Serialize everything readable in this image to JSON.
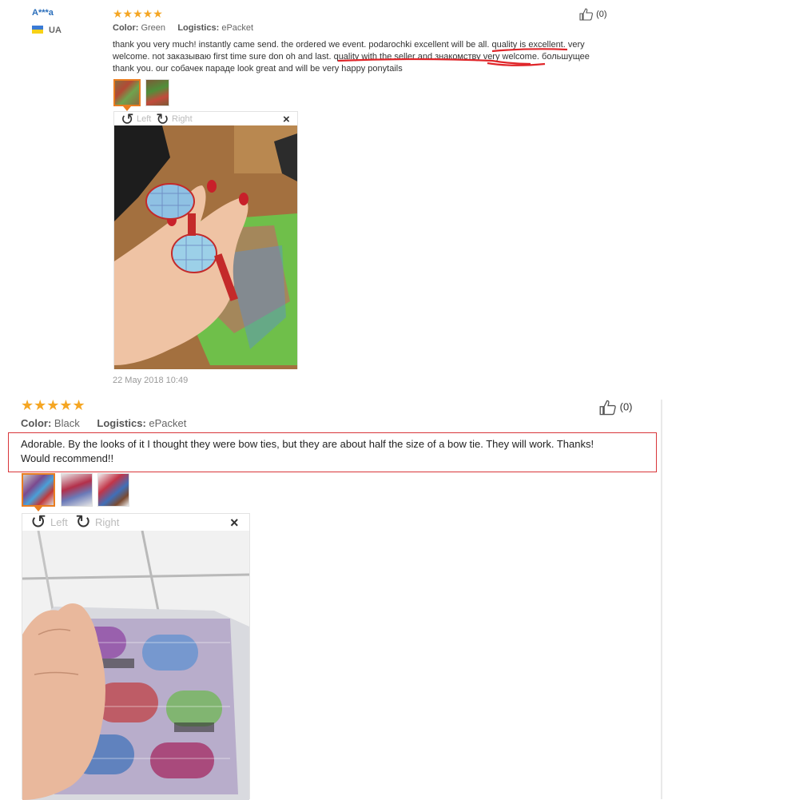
{
  "review1": {
    "user_name": "A***a",
    "country": "UA",
    "stars": "★★★★★",
    "color_label": "Color:",
    "color_value": "Green",
    "logistics_label": "Logistics:",
    "logistics_value": "ePacket",
    "like_count": "(0)",
    "text_line1": "thank you very much! instantly came send. the ordered we event. podarochki excellent will be all. quality is excellent. very",
    "text_line2": "welcome. not заказываю first time sure don oh and last. quality with the seller and знакомству very welcome. большущее",
    "text_line3": "thank you. our собачек параде look great and will be very happy ponytails",
    "rotate_left": "Left",
    "rotate_right": "Right",
    "close": "×",
    "date": "22 May 2018 10:49"
  },
  "review2": {
    "stars": "★★★★★",
    "color_label": "Color:",
    "color_value": "Black",
    "logistics_label": "Logistics:",
    "logistics_value": "ePacket",
    "like_count": "(0)",
    "text_line1": "Adorable. By the looks of it I thought they were bow ties, but they are about half the size of a bow tie. They will work. Thanks!",
    "text_line2": "Would recommend!!",
    "rotate_left": "Left",
    "rotate_right": "Right",
    "close": "×"
  },
  "colors": {
    "star": "#f5a623",
    "user_link": "#2a6ebb",
    "highlight_red": "#e0262a",
    "thumb_selected": "#e97d20"
  }
}
